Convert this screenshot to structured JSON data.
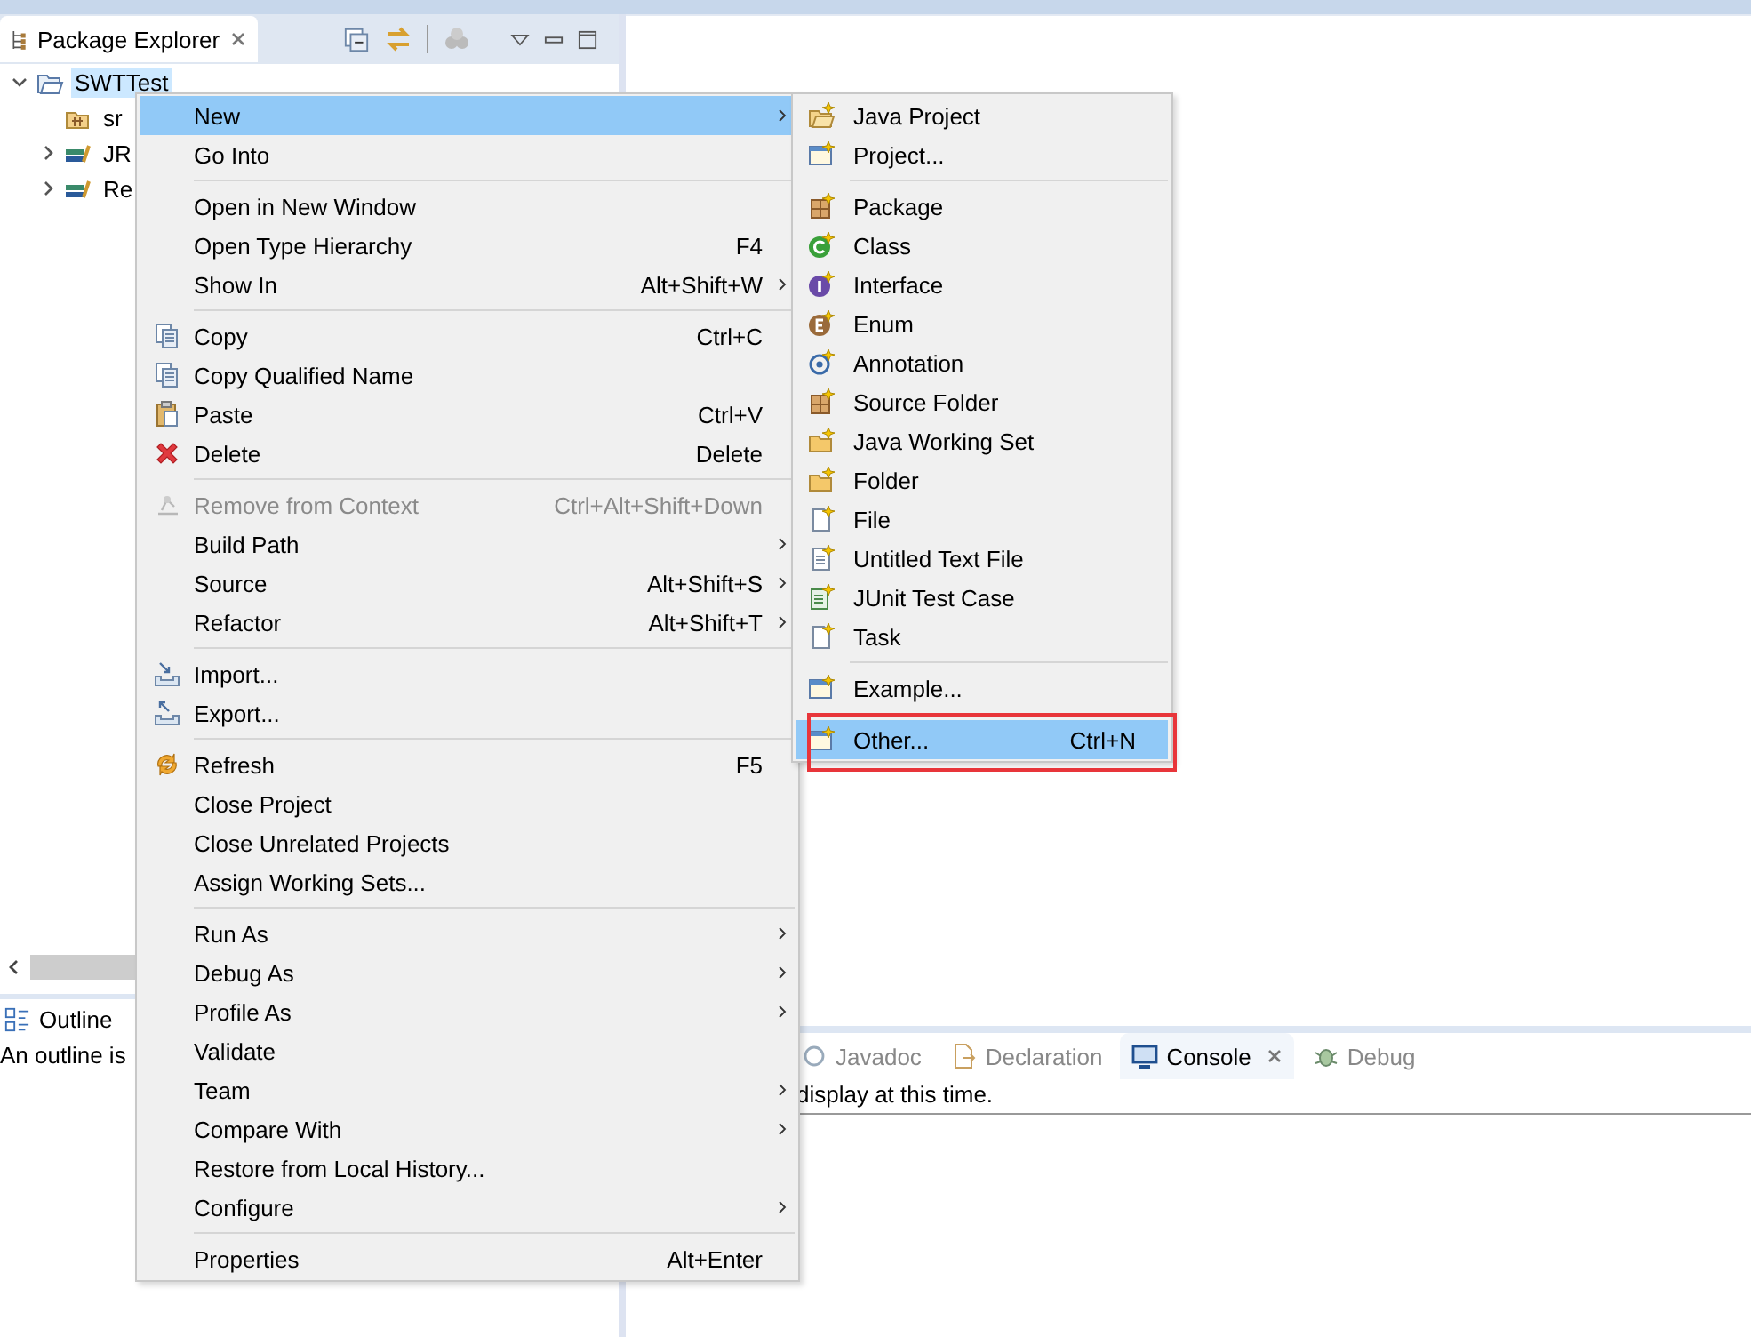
{
  "package_explorer": {
    "tab": {
      "title": "Package Explorer",
      "selected": true
    },
    "tree": [
      {
        "label": "SWTTest",
        "kind": "project",
        "expanded": true,
        "selected": true,
        "children": [
          {
            "label": "sr",
            "kind": "source-folder",
            "selected": false
          },
          {
            "label": "JR",
            "kind": "library",
            "expanded": false,
            "selected": false
          },
          {
            "label": "Re",
            "kind": "library",
            "expanded": false,
            "selected": false
          }
        ]
      }
    ]
  },
  "outline": {
    "tab": {
      "title": "Outline",
      "selected": true
    },
    "message": "An outline is"
  },
  "bottom_panel": {
    "tabs": [
      {
        "label": "Javadoc",
        "kind": "javadoc",
        "selected": false
      },
      {
        "label": "Declaration",
        "kind": "declaration",
        "selected": false
      },
      {
        "label": "Console",
        "kind": "console",
        "selected": true
      },
      {
        "label": "Debug",
        "kind": "debug",
        "selected": false
      }
    ],
    "message": "display at this time."
  },
  "context_menu": {
    "items": [
      {
        "kind": "plain",
        "label": "New",
        "submenu": true,
        "selected": true,
        "disabled": false
      },
      {
        "kind": "plain",
        "label": "Go Into",
        "submenu": false,
        "selected": false,
        "disabled": false
      },
      {
        "kind": "separator"
      },
      {
        "kind": "plain",
        "label": "Open in New Window",
        "submenu": false,
        "selected": false,
        "disabled": false
      },
      {
        "kind": "plain",
        "label": "Open Type Hierarchy",
        "shortcut": "F4",
        "submenu": false,
        "selected": false,
        "disabled": false
      },
      {
        "kind": "plain",
        "label": "Show In",
        "shortcut": "Alt+Shift+W",
        "submenu": true,
        "selected": false,
        "disabled": false
      },
      {
        "kind": "separator"
      },
      {
        "kind": "copy",
        "label": "Copy",
        "shortcut": "Ctrl+C",
        "submenu": false,
        "selected": false,
        "disabled": false
      },
      {
        "kind": "copy",
        "label": "Copy Qualified Name",
        "submenu": false,
        "selected": false,
        "disabled": false
      },
      {
        "kind": "paste",
        "label": "Paste",
        "shortcut": "Ctrl+V",
        "submenu": false,
        "selected": false,
        "disabled": false
      },
      {
        "kind": "delete",
        "label": "Delete",
        "shortcut": "Delete",
        "submenu": false,
        "selected": false,
        "disabled": false
      },
      {
        "kind": "separator"
      },
      {
        "kind": "remove",
        "label": "Remove from Context",
        "shortcut": "Ctrl+Alt+Shift+Down",
        "submenu": false,
        "selected": false,
        "disabled": true
      },
      {
        "kind": "plain",
        "label": "Build Path",
        "submenu": true,
        "selected": false,
        "disabled": false
      },
      {
        "kind": "plain",
        "label": "Source",
        "shortcut": "Alt+Shift+S",
        "submenu": true,
        "selected": false,
        "disabled": false
      },
      {
        "kind": "plain",
        "label": "Refactor",
        "shortcut": "Alt+Shift+T",
        "submenu": true,
        "selected": false,
        "disabled": false
      },
      {
        "kind": "separator"
      },
      {
        "kind": "import",
        "label": "Import...",
        "submenu": false,
        "selected": false,
        "disabled": false
      },
      {
        "kind": "export",
        "label": "Export...",
        "submenu": false,
        "selected": false,
        "disabled": false
      },
      {
        "kind": "separator"
      },
      {
        "kind": "refresh",
        "label": "Refresh",
        "shortcut": "F5",
        "submenu": false,
        "selected": false,
        "disabled": false
      },
      {
        "kind": "plain",
        "label": "Close Project",
        "submenu": false,
        "selected": false,
        "disabled": false
      },
      {
        "kind": "plain",
        "label": "Close Unrelated Projects",
        "submenu": false,
        "selected": false,
        "disabled": false
      },
      {
        "kind": "plain",
        "label": "Assign Working Sets...",
        "submenu": false,
        "selected": false,
        "disabled": false
      },
      {
        "kind": "separator"
      },
      {
        "kind": "plain",
        "label": "Run As",
        "submenu": true,
        "selected": false,
        "disabled": false
      },
      {
        "kind": "plain",
        "label": "Debug As",
        "submenu": true,
        "selected": false,
        "disabled": false
      },
      {
        "kind": "plain",
        "label": "Profile As",
        "submenu": true,
        "selected": false,
        "disabled": false
      },
      {
        "kind": "plain",
        "label": "Validate",
        "submenu": false,
        "selected": false,
        "disabled": false
      },
      {
        "kind": "plain",
        "label": "Team",
        "submenu": true,
        "selected": false,
        "disabled": false
      },
      {
        "kind": "plain",
        "label": "Compare With",
        "submenu": true,
        "selected": false,
        "disabled": false
      },
      {
        "kind": "plain",
        "label": "Restore from Local History...",
        "submenu": false,
        "selected": false,
        "disabled": false
      },
      {
        "kind": "plain",
        "label": "Configure",
        "submenu": true,
        "selected": false,
        "disabled": false
      },
      {
        "kind": "separator"
      },
      {
        "kind": "plain",
        "label": "Properties",
        "shortcut": "Alt+Enter",
        "submenu": false,
        "selected": false,
        "disabled": false
      }
    ]
  },
  "new_submenu": {
    "items": [
      {
        "kind": "java-project",
        "label": "Java Project",
        "selected": false,
        "outlined": false
      },
      {
        "kind": "window",
        "label": "Project...",
        "selected": false,
        "outlined": false
      },
      {
        "kind": "separator"
      },
      {
        "kind": "package",
        "label": "Package",
        "selected": false,
        "outlined": false
      },
      {
        "kind": "class",
        "label": "Class",
        "selected": false,
        "outlined": false
      },
      {
        "kind": "interface",
        "label": "Interface",
        "selected": false,
        "outlined": false
      },
      {
        "kind": "enum",
        "label": "Enum",
        "selected": false,
        "outlined": false
      },
      {
        "kind": "annotation",
        "label": "Annotation",
        "selected": false,
        "outlined": false
      },
      {
        "kind": "package",
        "label": "Source Folder",
        "selected": false,
        "outlined": false
      },
      {
        "kind": "folder",
        "label": "Java Working Set",
        "selected": false,
        "outlined": false
      },
      {
        "kind": "folder",
        "label": "Folder",
        "selected": false,
        "outlined": false
      },
      {
        "kind": "file",
        "label": "File",
        "selected": false,
        "outlined": false
      },
      {
        "kind": "text-file",
        "label": "Untitled Text File",
        "selected": false,
        "outlined": false
      },
      {
        "kind": "test-file",
        "label": "JUnit Test Case",
        "selected": false,
        "outlined": false
      },
      {
        "kind": "file",
        "label": "Task",
        "selected": false,
        "outlined": false
      },
      {
        "kind": "separator"
      },
      {
        "kind": "window",
        "label": "Example...",
        "selected": false,
        "outlined": false
      },
      {
        "kind": "separator"
      },
      {
        "kind": "window",
        "label": "Other...",
        "shortcut": "Ctrl+N",
        "selected": true,
        "outlined": true
      }
    ]
  }
}
